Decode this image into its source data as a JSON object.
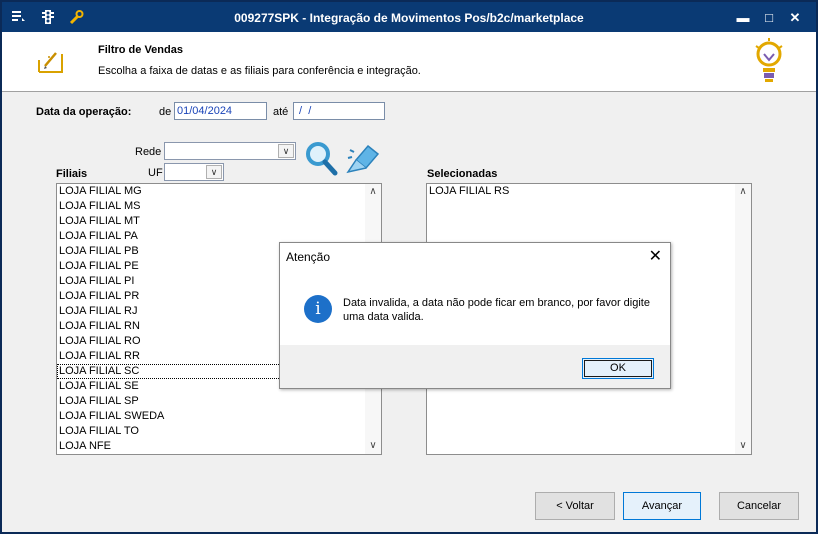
{
  "window": {
    "title": "009277SPK - Integração de Movimentos Pos/b2c/marketplace",
    "icons": [
      "list-icon",
      "traffic-light-icon",
      "wrench-icon"
    ],
    "controls": {
      "minimize": "▬",
      "maximize": "□",
      "close": "✕"
    }
  },
  "header": {
    "title": "Filtro de Vendas",
    "subtitle": "Escolha a faixa de datas e as filiais para conferência e integração."
  },
  "filter": {
    "date_label": "Data da operação:",
    "from_label": "de",
    "from_value": "01/04/2024",
    "to_label": "até",
    "to_value": " /  /",
    "rede_label": "Rede",
    "rede_value": "",
    "uf_label": "UF",
    "uf_value": ""
  },
  "filiais": {
    "label": "Filiais",
    "items": [
      "LOJA FILIAL MG",
      "LOJA FILIAL MS",
      "LOJA FILIAL MT",
      "LOJA FILIAL PA",
      "LOJA FILIAL PB",
      "LOJA FILIAL PE",
      "LOJA FILIAL PI",
      "LOJA FILIAL PR",
      "LOJA FILIAL RJ",
      "LOJA FILIAL RN",
      "LOJA FILIAL RO",
      "LOJA FILIAL RR",
      "LOJA FILIAL SC",
      "LOJA FILIAL SE",
      "LOJA FILIAL SP",
      "LOJA FILIAL SWEDA",
      "LOJA FILIAL TO",
      "LOJA NFE"
    ]
  },
  "selecionadas": {
    "label": "Selecionadas",
    "items": [
      "LOJA FILIAL RS"
    ]
  },
  "buttons": {
    "back": "< Voltar",
    "next": "Avançar",
    "cancel": "Cancelar"
  },
  "dialog": {
    "title": "Atenção",
    "close": "✕",
    "icon": "info-icon",
    "message": "Data invalida, a data não pode ficar em branco, por favor digite uma data valida.",
    "ok": "OK"
  },
  "colors": {
    "titlebar": "#0a3a74",
    "accent": "#0078d7",
    "info": "#1d70c9"
  }
}
